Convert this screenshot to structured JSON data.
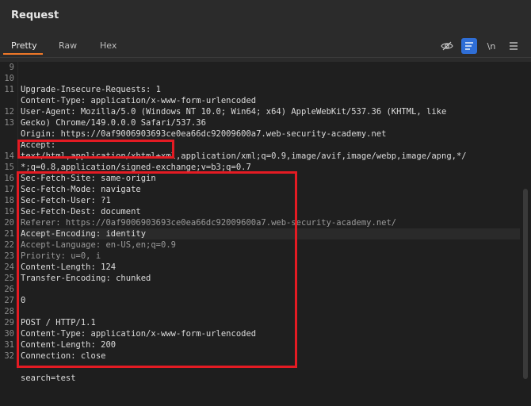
{
  "panel": {
    "title": "Request"
  },
  "tabs": [
    {
      "label": "Pretty",
      "active": true
    },
    {
      "label": "Raw",
      "active": false
    },
    {
      "label": "Hex",
      "active": false
    }
  ],
  "tools": {
    "hide_icon": "eye-slash-icon",
    "wrap_icon": "wrap-lines-icon",
    "newline_label": "\\n",
    "menu_icon": "hamburger-icon"
  },
  "lines": [
    {
      "n": "9",
      "text": "Upgrade-Insecure-Requests: 1"
    },
    {
      "n": "10",
      "text": "Content-Type: application/x-www-form-urlencoded"
    },
    {
      "n": "11",
      "text": "User-Agent: Mozilla/5.0 (Windows NT 10.0; Win64; x64) AppleWebKit/537.36 (KHTML, like"
    },
    {
      "n": "",
      "text": "Gecko) Chrome/149.0.0.0 Safari/537.36"
    },
    {
      "n": "12",
      "text": "Origin: https://0af9006903693ce0ea66dc92009600a7.web-security-academy.net"
    },
    {
      "n": "13",
      "text": "Accept:"
    },
    {
      "n": "",
      "text": "text/html,application/xhtml+xml,application/xml;q=0.9,image/avif,image/webp,image/apng,*/"
    },
    {
      "n": "",
      "text": "*;q=0.8,application/signed-exchange;v=b3;q=0.7"
    },
    {
      "n": "14",
      "text": "Sec-Fetch-Site: same-origin"
    },
    {
      "n": "15",
      "text": "Sec-Fetch-Mode: navigate"
    },
    {
      "n": "16",
      "text": "Sec-Fetch-User: ?1"
    },
    {
      "n": "17",
      "text": "Sec-Fetch-Dest: document"
    },
    {
      "n": "18",
      "text": "Referer: https://0af9006903693ce0ea66dc92009600a7.web-security-academy.net/"
    },
    {
      "n": "19",
      "text": "Accept-Encoding: identity"
    },
    {
      "n": "20",
      "text": "Accept-Language: en-US,en;q=0.9"
    },
    {
      "n": "21",
      "text": "Priority: u=0, i"
    },
    {
      "n": "22",
      "text": "Content-Length: 124"
    },
    {
      "n": "23",
      "text": "Transfer-Encoding: chunked"
    },
    {
      "n": "24",
      "text": ""
    },
    {
      "n": "25",
      "text": "0"
    },
    {
      "n": "26",
      "text": ""
    },
    {
      "n": "27",
      "text": "POST / HTTP/1.1"
    },
    {
      "n": "28",
      "text": "Content-Type: application/x-www-form-urlencoded"
    },
    {
      "n": "29",
      "text": "Content-Length: 200"
    },
    {
      "n": "30",
      "text": "Connection: close"
    },
    {
      "n": "31",
      "text": ""
    },
    {
      "n": "32",
      "text": "search=test"
    }
  ]
}
